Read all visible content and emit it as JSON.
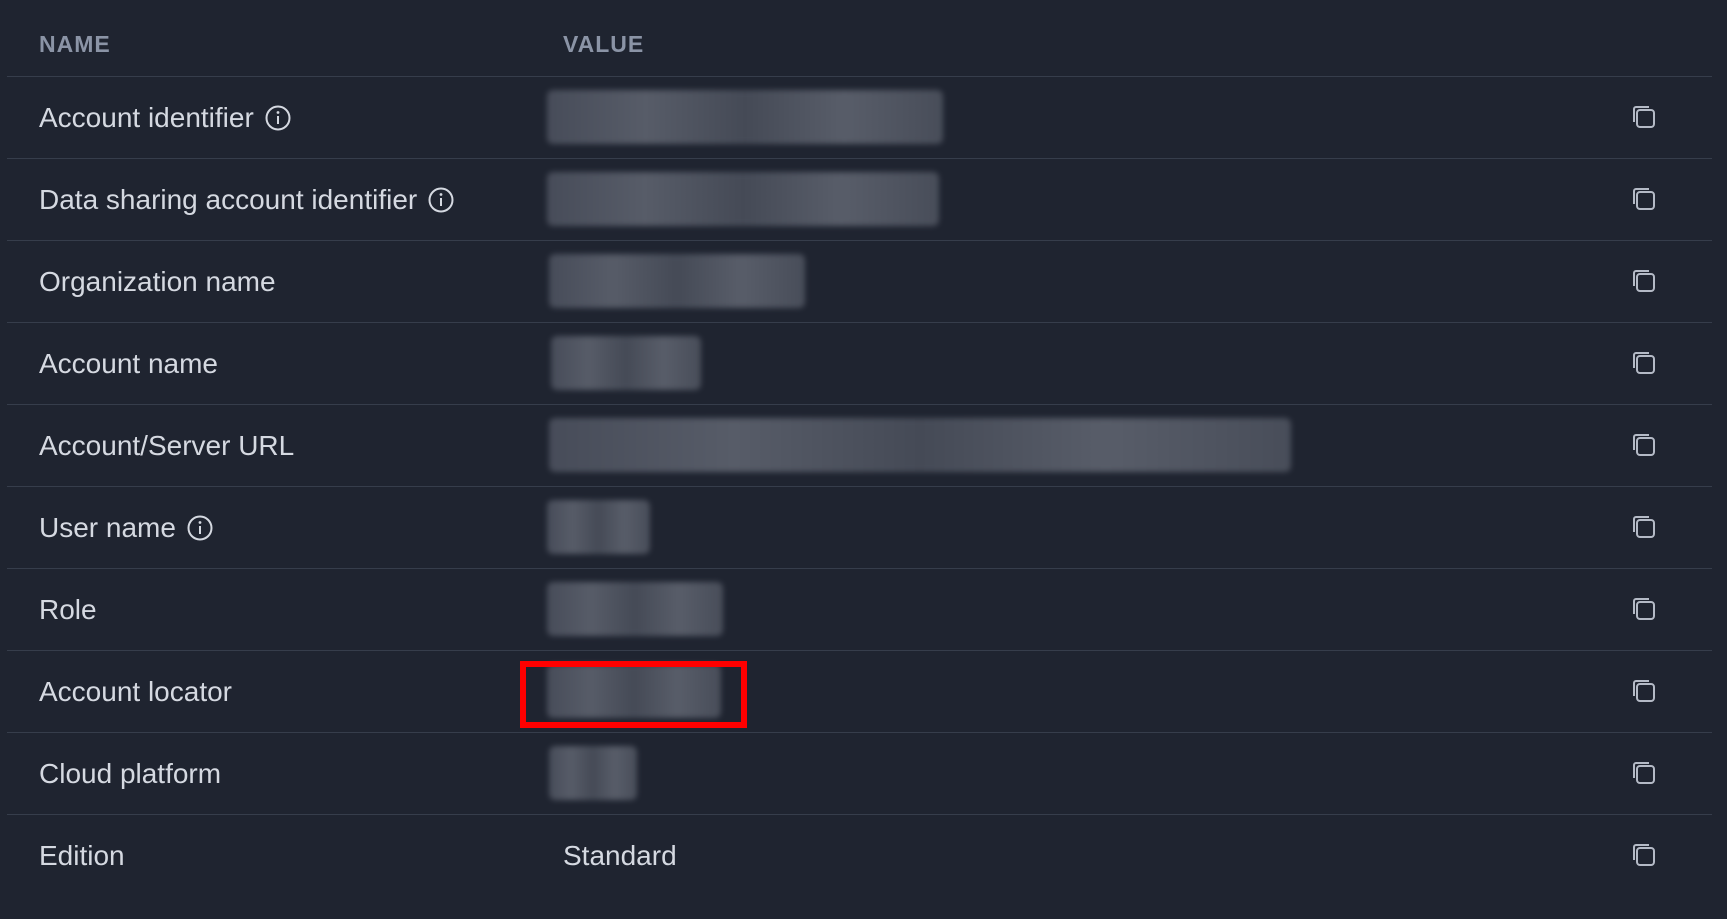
{
  "header": {
    "name_label": "NAME",
    "value_label": "VALUE"
  },
  "rows": [
    {
      "name": "Account identifier",
      "info": true,
      "value": "",
      "redacted": true
    },
    {
      "name": "Data sharing account identifier",
      "info": true,
      "value": "",
      "redacted": true
    },
    {
      "name": "Organization name",
      "info": false,
      "value": "",
      "redacted": true
    },
    {
      "name": "Account name",
      "info": false,
      "value": "",
      "redacted": true
    },
    {
      "name": "Account/Server URL",
      "info": false,
      "value": "",
      "redacted": true
    },
    {
      "name": "User name",
      "info": true,
      "value": "",
      "redacted": true
    },
    {
      "name": "Role",
      "info": false,
      "value": "",
      "redacted": true
    },
    {
      "name": "Account locator",
      "info": false,
      "value": "",
      "redacted": true,
      "highlighted": true
    },
    {
      "name": "Cloud platform",
      "info": false,
      "value": "",
      "redacted": true
    },
    {
      "name": "Edition",
      "info": false,
      "value": "Standard",
      "redacted": false
    }
  ],
  "icons": {
    "info": "info-circle-icon",
    "copy": "copy-icon"
  },
  "colors": {
    "background": "#1f2430",
    "text": "#d5d9e1",
    "header_text": "#8b94a6",
    "divider": "#363d4b",
    "highlight": "#ff0000"
  }
}
